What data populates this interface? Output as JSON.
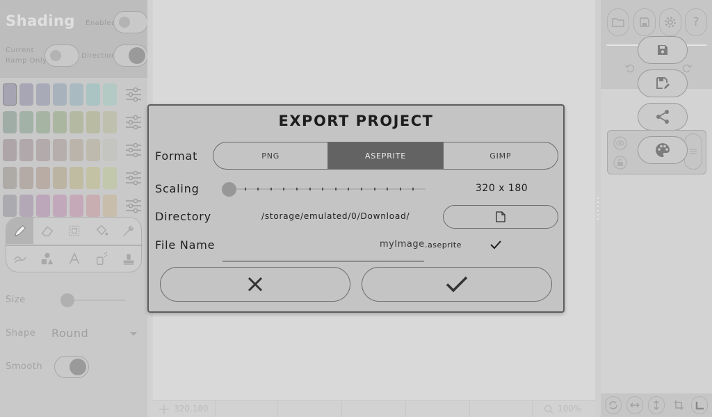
{
  "app": {
    "left_panel": {
      "title": "Shading",
      "enabled_label": "Enabled",
      "current_ramp_label_line1": "Current",
      "current_ramp_label_line2": "Ramp Only",
      "direction_label": "Direction",
      "size_label": "Size",
      "shape_label": "Shape",
      "shape_value": "Round",
      "smooth_label": "Smooth",
      "tools": [
        "pencil-icon",
        "eraser-icon",
        "select-icon",
        "bucket-icon",
        "eyedropper-icon",
        "shading-icon",
        "shapes-icon",
        "text-icon",
        "spray-icon",
        "stamp-icon"
      ]
    },
    "status_bar": {
      "coords": "320,180",
      "zoom": "100%"
    },
    "right_panel": {
      "top_buttons": [
        "folder-open-icon",
        "save-small-icon",
        "settings-icon",
        "help-icon"
      ],
      "pill_buttons": [
        "save-icon",
        "save-as-icon",
        "share-icon",
        "palette-icon"
      ],
      "bottom_tools": [
        "rotate-icon",
        "flip-horizontal-icon",
        "flip-vertical-icon",
        "crop-icon",
        "resize-icon"
      ]
    },
    "swatch_colors": [
      [
        "#a6a3b2",
        "#a8a6b4",
        "#a8aab8",
        "#a8b2bd",
        "#a9bac1",
        "#aac3c3",
        "#b2cac3"
      ],
      [
        "#9fada6",
        "#a3b2a6",
        "#a6b4a4",
        "#abb6a1",
        "#b3baa1",
        "#b9bca2",
        "#c0c0ae"
      ],
      [
        "#ada5a8",
        "#b0a8aa",
        "#b3aaac",
        "#b6aeac",
        "#bab4ab",
        "#bebbae",
        "#c4c4c0"
      ],
      [
        "#aeaaa6",
        "#b4aaa6",
        "#b8aca4",
        "#bcb4a2",
        "#c0bca2",
        "#c3c2a4",
        "#c2c8ac"
      ],
      [
        "#aaaab0",
        "#b2a8b6",
        "#bca6b9",
        "#c2a8bb",
        "#c6a9b8",
        "#c8adb1",
        "#c8bcaa"
      ]
    ]
  },
  "modal": {
    "title": "EXPORT PROJECT",
    "format": {
      "label": "Format",
      "options": [
        "PNG",
        "ASEPRITE",
        "GIMP"
      ],
      "selected": "ASEPRITE"
    },
    "scaling": {
      "label": "Scaling",
      "value": "320 x 180",
      "level": 0
    },
    "directory": {
      "label": "Directory",
      "path": "/storage/emulated/0/Download/",
      "button_icon": "file-icon"
    },
    "file_name": {
      "label": "File Name",
      "value": "myImage",
      "extension": ".aseprite"
    },
    "actions": {
      "cancel_icon": "close-icon",
      "confirm_icon": "check-icon"
    }
  }
}
